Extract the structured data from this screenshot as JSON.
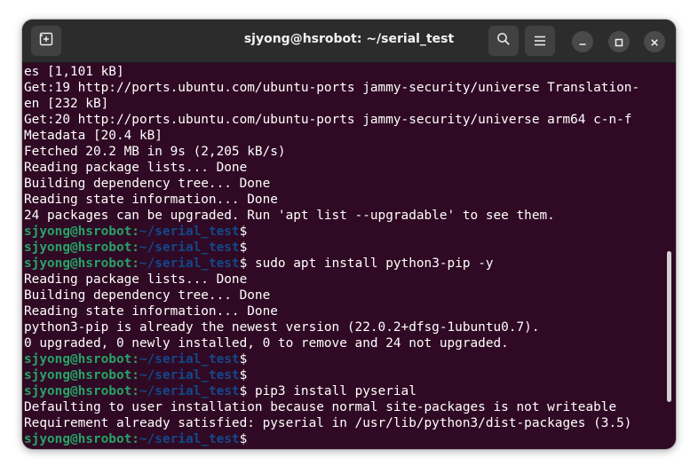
{
  "window": {
    "title": "sjyong@hsrobot: ~/serial_test"
  },
  "icons": {
    "new_tab": "new-tab-icon",
    "search": "search-icon",
    "menu": "hamburger-menu-icon",
    "minimize": "minimize-icon",
    "maximize": "maximize-icon",
    "close": "close-icon"
  },
  "colors": {
    "terminal_bg": "#300a24",
    "prompt_user": "#26a269",
    "prompt_path": "#12488b",
    "text": "#ffffff"
  },
  "prompt": {
    "user_host": "sjyong@hsrobot",
    "separator": ":",
    "path": "~/serial_test",
    "symbol": "$"
  },
  "terminal": {
    "lines": [
      {
        "type": "out",
        "text": "es [1,101 kB]"
      },
      {
        "type": "out",
        "text": "Get:19 http://ports.ubuntu.com/ubuntu-ports jammy-security/universe Translation-"
      },
      {
        "type": "out",
        "text": "en [232 kB]"
      },
      {
        "type": "out",
        "text": "Get:20 http://ports.ubuntu.com/ubuntu-ports jammy-security/universe arm64 c-n-f"
      },
      {
        "type": "out",
        "text": "Metadata [20.4 kB]"
      },
      {
        "type": "out",
        "text": "Fetched 20.2 MB in 9s (2,205 kB/s)"
      },
      {
        "type": "out",
        "text": "Reading package lists... Done"
      },
      {
        "type": "out",
        "text": "Building dependency tree... Done"
      },
      {
        "type": "out",
        "text": "Reading state information... Done"
      },
      {
        "type": "out",
        "text": "24 packages can be upgraded. Run 'apt list --upgradable' to see them."
      },
      {
        "type": "prompt",
        "cmd": ""
      },
      {
        "type": "prompt",
        "cmd": ""
      },
      {
        "type": "prompt",
        "cmd": " sudo apt install python3-pip -y"
      },
      {
        "type": "out",
        "text": "Reading package lists... Done"
      },
      {
        "type": "out",
        "text": "Building dependency tree... Done"
      },
      {
        "type": "out",
        "text": "Reading state information... Done"
      },
      {
        "type": "out",
        "text": "python3-pip is already the newest version (22.0.2+dfsg-1ubuntu0.7)."
      },
      {
        "type": "out",
        "text": "0 upgraded, 0 newly installed, 0 to remove and 24 not upgraded."
      },
      {
        "type": "prompt",
        "cmd": ""
      },
      {
        "type": "prompt",
        "cmd": ""
      },
      {
        "type": "prompt",
        "cmd": " pip3 install pyserial"
      },
      {
        "type": "out",
        "text": "Defaulting to user installation because normal site-packages is not writeable"
      },
      {
        "type": "out",
        "text": "Requirement already satisfied: pyserial in /usr/lib/python3/dist-packages (3.5)"
      },
      {
        "type": "prompt",
        "cmd": ""
      }
    ]
  }
}
